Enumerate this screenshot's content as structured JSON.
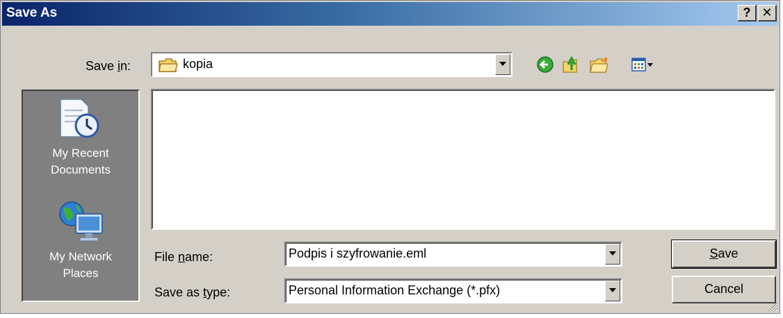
{
  "window": {
    "title": "Save As",
    "help_label": "?",
    "close_label": "✕"
  },
  "save_in": {
    "label_pre": "Save ",
    "label_accel": "i",
    "label_post": "n:",
    "value": "kopia",
    "icon": "folder-icon"
  },
  "toolbar": {
    "back_icon": "back-icon",
    "up_icon": "up-folder-icon",
    "new_folder_icon": "new-folder-icon",
    "views_icon": "views-menu-icon"
  },
  "places": {
    "recent_line1": "My Recent",
    "recent_line2": "Documents",
    "network_line1": "My Network",
    "network_line2": "Places"
  },
  "file_name": {
    "label_pre": "File ",
    "label_accel": "n",
    "label_post": "ame:",
    "value": "Podpis i szyfrowanie.eml"
  },
  "save_type": {
    "label_pre": "Save as ",
    "label_accel": "t",
    "label_post": "ype:",
    "value": "Personal Information Exchange (*.pfx)"
  },
  "buttons": {
    "save_accel": "S",
    "save_rest": "ave",
    "cancel": "Cancel"
  },
  "colors": {
    "title_start": "#0a246a",
    "title_end": "#a6caf0",
    "face": "#d4d0c8",
    "places_bg": "#808080"
  }
}
